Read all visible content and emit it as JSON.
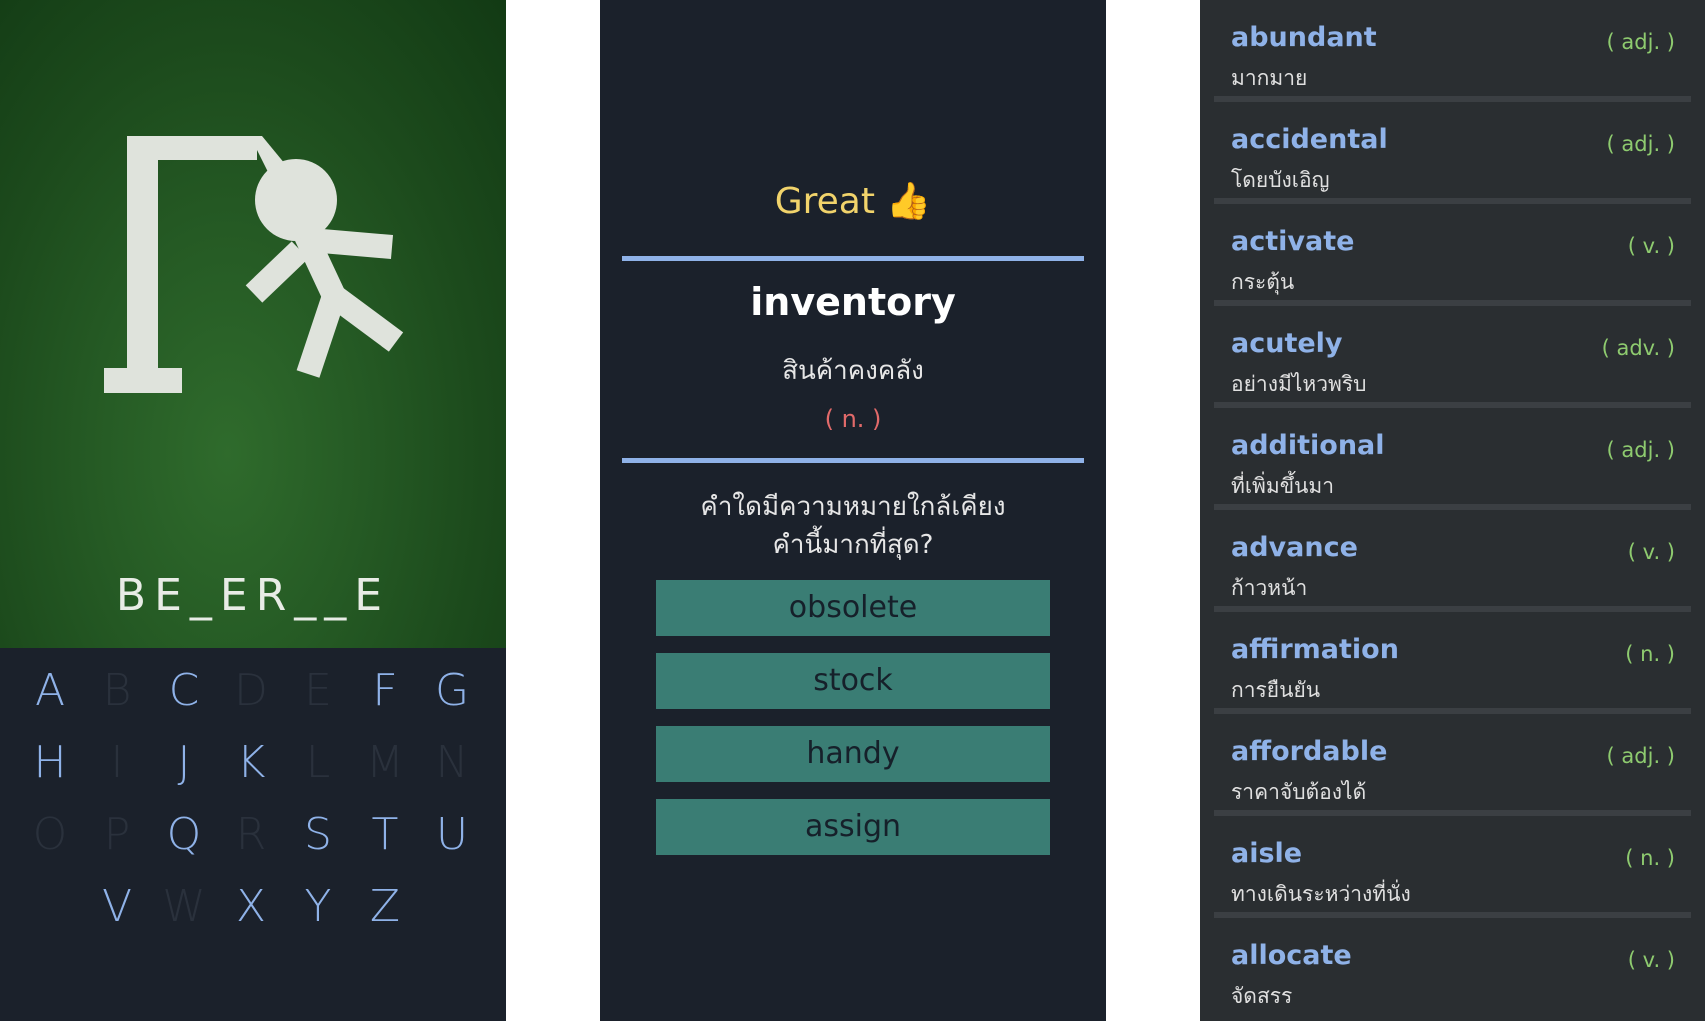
{
  "hangman": {
    "hint_word": "BE_ER__E",
    "keyboard": [
      {
        "letter": "A",
        "used": false
      },
      {
        "letter": "B",
        "used": true
      },
      {
        "letter": "C",
        "used": false
      },
      {
        "letter": "D",
        "used": true
      },
      {
        "letter": "E",
        "used": true
      },
      {
        "letter": "F",
        "used": false
      },
      {
        "letter": "G",
        "used": false
      },
      {
        "letter": "H",
        "used": false
      },
      {
        "letter": "I",
        "used": true
      },
      {
        "letter": "J",
        "used": false
      },
      {
        "letter": "K",
        "used": false
      },
      {
        "letter": "L",
        "used": true
      },
      {
        "letter": "M",
        "used": true
      },
      {
        "letter": "N",
        "used": true
      },
      {
        "letter": "O",
        "used": true
      },
      {
        "letter": "P",
        "used": true
      },
      {
        "letter": "Q",
        "used": false
      },
      {
        "letter": "R",
        "used": true
      },
      {
        "letter": "S",
        "used": false
      },
      {
        "letter": "T",
        "used": false
      },
      {
        "letter": "U",
        "used": false
      },
      {
        "letter": "V",
        "used": false
      },
      {
        "letter": "W",
        "used": true
      },
      {
        "letter": "X",
        "used": false
      },
      {
        "letter": "Y",
        "used": false
      },
      {
        "letter": "Z",
        "used": false
      }
    ]
  },
  "quiz": {
    "praise": "Great 👍",
    "word": "inventory",
    "translation": "สินค้าคงคลัง",
    "part_of_speech": "( n. )",
    "question_line1": "คำใดมีความหมายใกล้เคียง",
    "question_line2": "คำนี้มากที่สุด?",
    "choices": [
      "obsolete",
      "stock",
      "handy",
      "assign"
    ]
  },
  "word_list": [
    {
      "word": "abundant",
      "meaning": "มากมาย",
      "pos": "( adj. )"
    },
    {
      "word": "accidental",
      "meaning": "โดยบังเอิญ",
      "pos": "( adj. )"
    },
    {
      "word": "activate",
      "meaning": "กระตุ้น",
      "pos": "( v. )"
    },
    {
      "word": "acutely",
      "meaning": "อย่างมีไหวพริบ",
      "pos": "( adv. )"
    },
    {
      "word": "additional",
      "meaning": "ที่เพิ่มขึ้นมา",
      "pos": "( adj. )"
    },
    {
      "word": "advance",
      "meaning": "ก้าวหน้า",
      "pos": "( v. )"
    },
    {
      "word": "affirmation",
      "meaning": "การยืนยัน",
      "pos": "( n. )"
    },
    {
      "word": "affordable",
      "meaning": "ราคาจับต้องได้",
      "pos": "( adj. )"
    },
    {
      "word": "aisle",
      "meaning": "ทางเดินระหว่างที่นั่ง",
      "pos": "( n. )"
    },
    {
      "word": "allocate",
      "meaning": "จัดสรร",
      "pos": "( v. )"
    }
  ],
  "colors": {
    "chalk": "#dfe3dc",
    "accent_blue": "#8fb2e8",
    "praise_yellow": "#f1d36b",
    "pos_red": "#e26a6a",
    "choice_teal": "#3a7d74",
    "tag_green": "#8ecb6f"
  }
}
